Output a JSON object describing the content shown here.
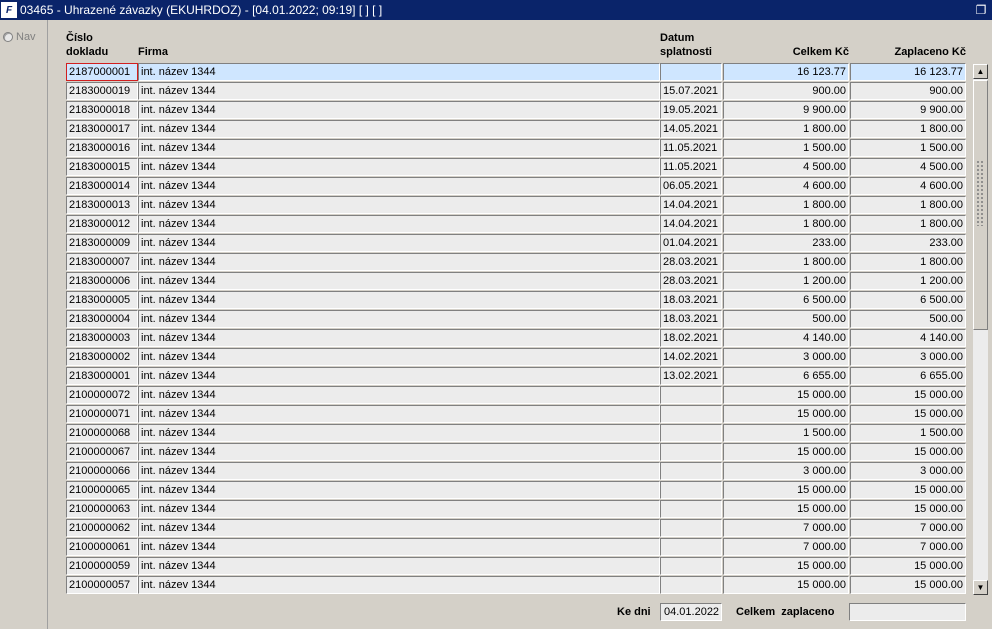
{
  "window": {
    "title": "03465 - Uhrazené závazky (EKUHRDOZ) - [04.01.2022; 09:19]  [ ]  [ ]",
    "app_icon_text": "F"
  },
  "left": {
    "nav_label": "Nav"
  },
  "columns": {
    "doc_line1": "Číslo",
    "doc_line2": "dokladu",
    "firm": "Firma",
    "date_line1": "Datum",
    "date_line2": "splatnosti",
    "total": "Celkem Kč",
    "paid": "Zaplaceno Kč"
  },
  "rows": [
    {
      "doc": "2187000001",
      "firm": "int. název 1344",
      "date": "",
      "total": "16 123.77",
      "paid": "16 123.77"
    },
    {
      "doc": "2183000019",
      "firm": "int. název 1344",
      "date": "15.07.2021",
      "total": "900.00",
      "paid": "900.00"
    },
    {
      "doc": "2183000018",
      "firm": "int. název 1344",
      "date": "19.05.2021",
      "total": "9 900.00",
      "paid": "9 900.00"
    },
    {
      "doc": "2183000017",
      "firm": "int. název 1344",
      "date": "14.05.2021",
      "total": "1 800.00",
      "paid": "1 800.00"
    },
    {
      "doc": "2183000016",
      "firm": "int. název 1344",
      "date": "11.05.2021",
      "total": "1 500.00",
      "paid": "1 500.00"
    },
    {
      "doc": "2183000015",
      "firm": "int. název 1344",
      "date": "11.05.2021",
      "total": "4 500.00",
      "paid": "4 500.00"
    },
    {
      "doc": "2183000014",
      "firm": "int. název 1344",
      "date": "06.05.2021",
      "total": "4 600.00",
      "paid": "4 600.00"
    },
    {
      "doc": "2183000013",
      "firm": "int. název 1344",
      "date": "14.04.2021",
      "total": "1 800.00",
      "paid": "1 800.00"
    },
    {
      "doc": "2183000012",
      "firm": "int. název 1344",
      "date": "14.04.2021",
      "total": "1 800.00",
      "paid": "1 800.00"
    },
    {
      "doc": "2183000009",
      "firm": "int. název 1344",
      "date": "01.04.2021",
      "total": "233.00",
      "paid": "233.00"
    },
    {
      "doc": "2183000007",
      "firm": "int. název 1344",
      "date": "28.03.2021",
      "total": "1 800.00",
      "paid": "1 800.00"
    },
    {
      "doc": "2183000006",
      "firm": "int. název 1344",
      "date": "28.03.2021",
      "total": "1 200.00",
      "paid": "1 200.00"
    },
    {
      "doc": "2183000005",
      "firm": "int. název 1344",
      "date": "18.03.2021",
      "total": "6 500.00",
      "paid": "6 500.00"
    },
    {
      "doc": "2183000004",
      "firm": "int. název 1344",
      "date": "18.03.2021",
      "total": "500.00",
      "paid": "500.00"
    },
    {
      "doc": "2183000003",
      "firm": "int. název 1344",
      "date": "18.02.2021",
      "total": "4 140.00",
      "paid": "4 140.00"
    },
    {
      "doc": "2183000002",
      "firm": "int. název 1344",
      "date": "14.02.2021",
      "total": "3 000.00",
      "paid": "3 000.00"
    },
    {
      "doc": "2183000001",
      "firm": "int. název 1344",
      "date": "13.02.2021",
      "total": "6 655.00",
      "paid": "6 655.00"
    },
    {
      "doc": "2100000072",
      "firm": "int. název 1344",
      "date": "",
      "total": "15 000.00",
      "paid": "15 000.00"
    },
    {
      "doc": "2100000071",
      "firm": "int. název 1344",
      "date": "",
      "total": "15 000.00",
      "paid": "15 000.00"
    },
    {
      "doc": "2100000068",
      "firm": "int. název 1344",
      "date": "",
      "total": "1 500.00",
      "paid": "1 500.00"
    },
    {
      "doc": "2100000067",
      "firm": "int. název 1344",
      "date": "",
      "total": "15 000.00",
      "paid": "15 000.00"
    },
    {
      "doc": "2100000066",
      "firm": "int. název 1344",
      "date": "",
      "total": "3 000.00",
      "paid": "3 000.00"
    },
    {
      "doc": "2100000065",
      "firm": "int. název 1344",
      "date": "",
      "total": "15 000.00",
      "paid": "15 000.00"
    },
    {
      "doc": "2100000063",
      "firm": "int. název 1344",
      "date": "",
      "total": "15 000.00",
      "paid": "15 000.00"
    },
    {
      "doc": "2100000062",
      "firm": "int. název 1344",
      "date": "",
      "total": "7 000.00",
      "paid": "7 000.00"
    },
    {
      "doc": "2100000061",
      "firm": "int. název 1344",
      "date": "",
      "total": "7 000.00",
      "paid": "7 000.00"
    },
    {
      "doc": "2100000059",
      "firm": "int. název 1344",
      "date": "",
      "total": "15 000.00",
      "paid": "15 000.00"
    },
    {
      "doc": "2100000057",
      "firm": "int. název 1344",
      "date": "",
      "total": "15 000.00",
      "paid": "15 000.00"
    }
  ],
  "footer": {
    "ke_dni_label": "Ke dni",
    "ke_dni_value": "04.01.2022",
    "celkem_label": "Celkem  zaplaceno",
    "celkem_value": ""
  },
  "colors": {
    "titlebar": "#0a246a",
    "selected_row": "#cfe6ff",
    "focus_border": "#d21f1f"
  }
}
